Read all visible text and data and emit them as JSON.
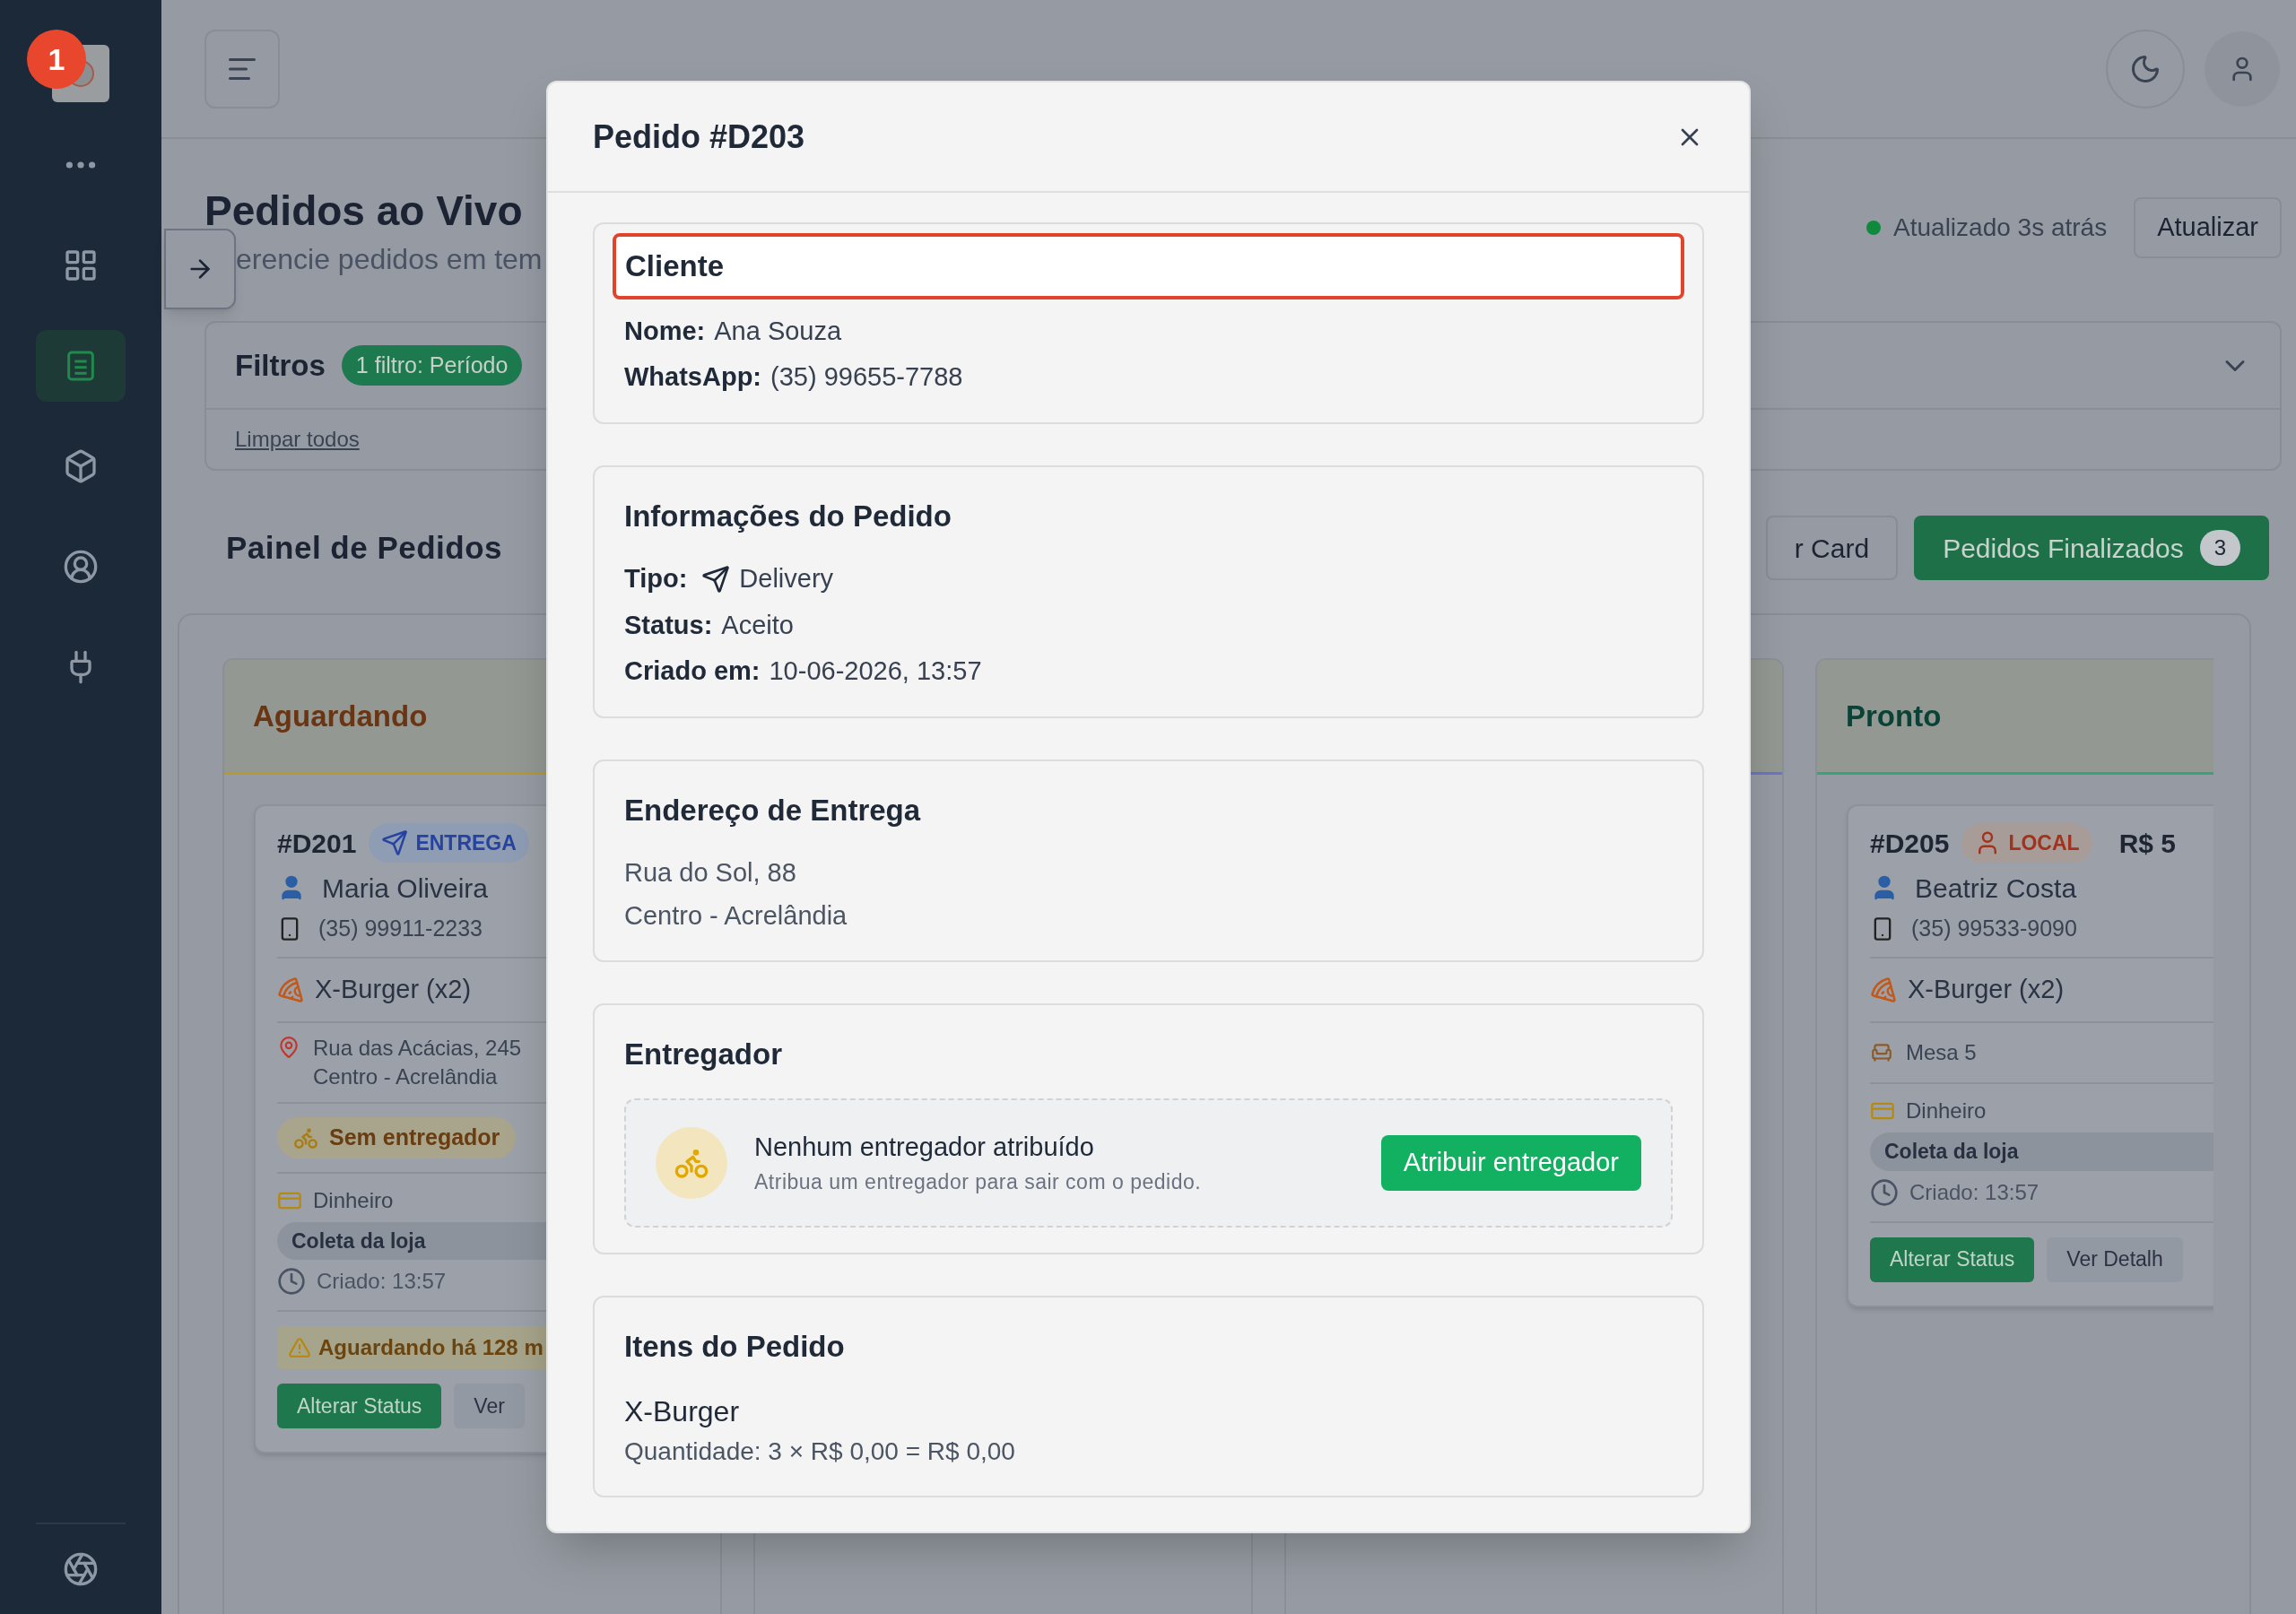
{
  "sidebar": {
    "badge": "1",
    "items": [
      {
        "selected": false
      },
      {
        "selected": false
      },
      {
        "selected": true
      },
      {
        "selected": false
      },
      {
        "selected": false
      },
      {
        "selected": false
      }
    ]
  },
  "page": {
    "title": "Pedidos ao Vivo",
    "subtitle": "erencie pedidos em tem",
    "update_status": "Atualizado 3s atrás",
    "refresh_button": "Atualizar"
  },
  "filters": {
    "title": "Filtros",
    "badge": "1 filtro: Período",
    "clear_link": "Limpar todos"
  },
  "board": {
    "title": "Painel de Pedidos",
    "buttons": [
      {
        "kind": "outline",
        "label": "r Card"
      },
      {
        "kind": "primary",
        "label": "Pedidos Finalizados",
        "count": "3"
      }
    ],
    "columns": [
      {
        "title": "Aguardando",
        "color": "#b59a2e",
        "cards": [
          {
            "id": "#D201",
            "badge": {
              "kind": "delivery",
              "label": "ENTREGA"
            },
            "customer": "Maria Oliveira",
            "phone": "(35) 99911-2233",
            "item": "X-Burger (x2)",
            "address": [
              "Rua das Acácias, 245",
              "Centro - Acrelândia"
            ],
            "courier": "Sem entregador",
            "payment": "Dinheiro",
            "pickup": "Coleta da loja",
            "created": "Criado: 13:57",
            "alert": "Aguardando há 128 m",
            "actions": [
              "Alterar Status",
              "Ver"
            ]
          }
        ]
      },
      {
        "color": "#6b74c9"
      },
      {
        "title": "Pronto",
        "color": "#3aa27a",
        "cards": [
          {
            "id": "#D205",
            "badge": {
              "kind": "local",
              "label": "LOCAL"
            },
            "total": "R$ 5",
            "customer": "Beatriz Costa",
            "phone": "(35) 99533-9090",
            "item": "X-Burger (x2)",
            "table": "Mesa 5",
            "payment": "Dinheiro",
            "pickup": "Coleta da loja",
            "created": "Criado: 13:57",
            "actions": [
              "Alterar Status",
              "Ver Detalh"
            ]
          }
        ]
      }
    ]
  },
  "dialog": {
    "title": "Pedido #D203",
    "sections": [
      {
        "kind": "fields",
        "title": "Cliente",
        "highlighted": true,
        "fields": [
          {
            "label": "Nome:",
            "value": "Ana Souza"
          },
          {
            "label": "WhatsApp:",
            "value": "(35) 99655-7788"
          }
        ]
      },
      {
        "kind": "fields",
        "title": "Informações do Pedido",
        "highlighted": false,
        "fields": [
          {
            "label": "Tipo:",
            "value": "Delivery",
            "with_icon": true
          },
          {
            "label": "Status:",
            "value": "Aceito"
          },
          {
            "label": "Criado em:",
            "value": "10-06-2026, 13:57"
          }
        ]
      },
      {
        "kind": "lines",
        "title": "Endereço de Entrega",
        "highlighted": false,
        "lines": [
          "Rua do Sol, 88",
          "Centro - Acrelândia"
        ]
      },
      {
        "kind": "courier",
        "title": "Entregador",
        "highlighted": false,
        "empty_title": "Nenhum entregador atribuído",
        "empty_hint": "Atribua um entregador para sair com o pedido.",
        "button": "Atribuir entregador"
      },
      {
        "kind": "items",
        "title": "Itens do Pedido",
        "highlighted": false,
        "items": [
          {
            "name": "X-Burger",
            "detail": "Quantidade: 3 × R$ 0,00 = R$ 0,00"
          }
        ]
      }
    ]
  }
}
